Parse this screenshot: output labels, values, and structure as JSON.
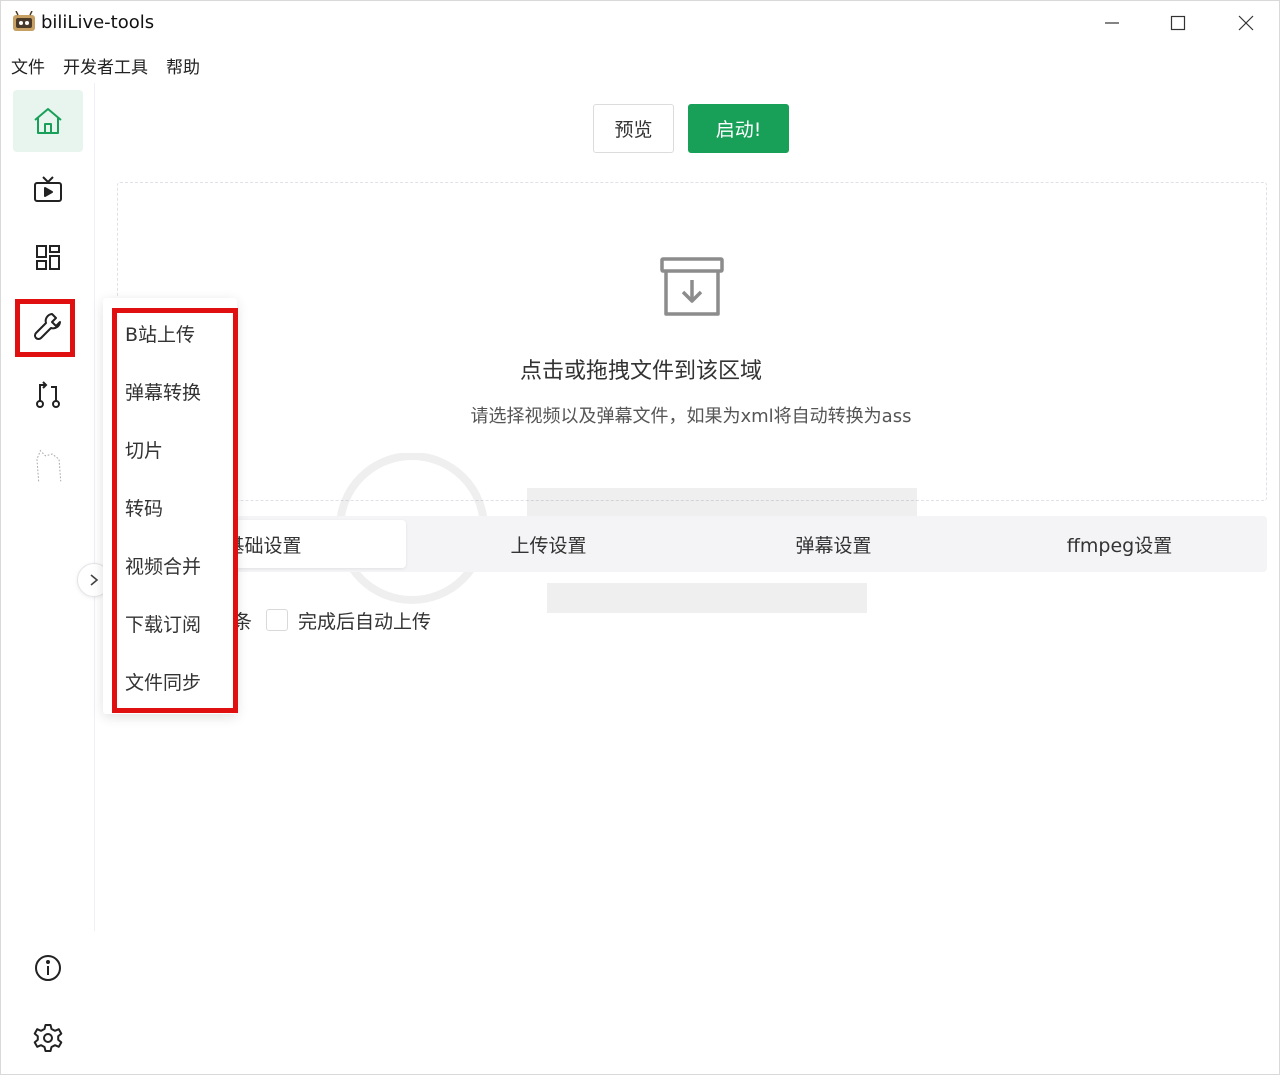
{
  "window": {
    "title": "biliLive-tools"
  },
  "menu": [
    "文件",
    "开发者工具",
    "帮助"
  ],
  "sidebar": {
    "items": [
      {
        "icon": "home-icon",
        "active": true
      },
      {
        "icon": "live-tv-icon",
        "active": false
      },
      {
        "icon": "dashboard-icon",
        "active": false
      },
      {
        "icon": "wrench-icon",
        "active": false,
        "highlighted": true
      },
      {
        "icon": "git-compare-icon",
        "active": false
      },
      {
        "icon": "mascot-icon",
        "active": false
      }
    ],
    "bottom": [
      {
        "icon": "info-icon"
      },
      {
        "icon": "gear-icon"
      }
    ]
  },
  "toolbar": {
    "preview_label": "预览",
    "start_label": "启动!"
  },
  "dropzone": {
    "title": "点击或拖拽文件到该区域",
    "subtitle": "请选择视频以及弹幕文件，如果为xml将自动转换为ass"
  },
  "tabs": [
    "基础设置",
    "上传设置",
    "弹幕设置",
    "ffmpeg设置"
  ],
  "options": {
    "partial_label": "条",
    "auto_upload_label": "完成后自动上传",
    "auto_upload_checked": false
  },
  "popup_menu": [
    "B站上传",
    "弹幕转换",
    "切片",
    "转码",
    "视频合并",
    "下载订阅",
    "文件同步"
  ],
  "colors": {
    "accent": "#18a058",
    "active_bg": "#e8f5ee",
    "highlight": "#e01010"
  }
}
